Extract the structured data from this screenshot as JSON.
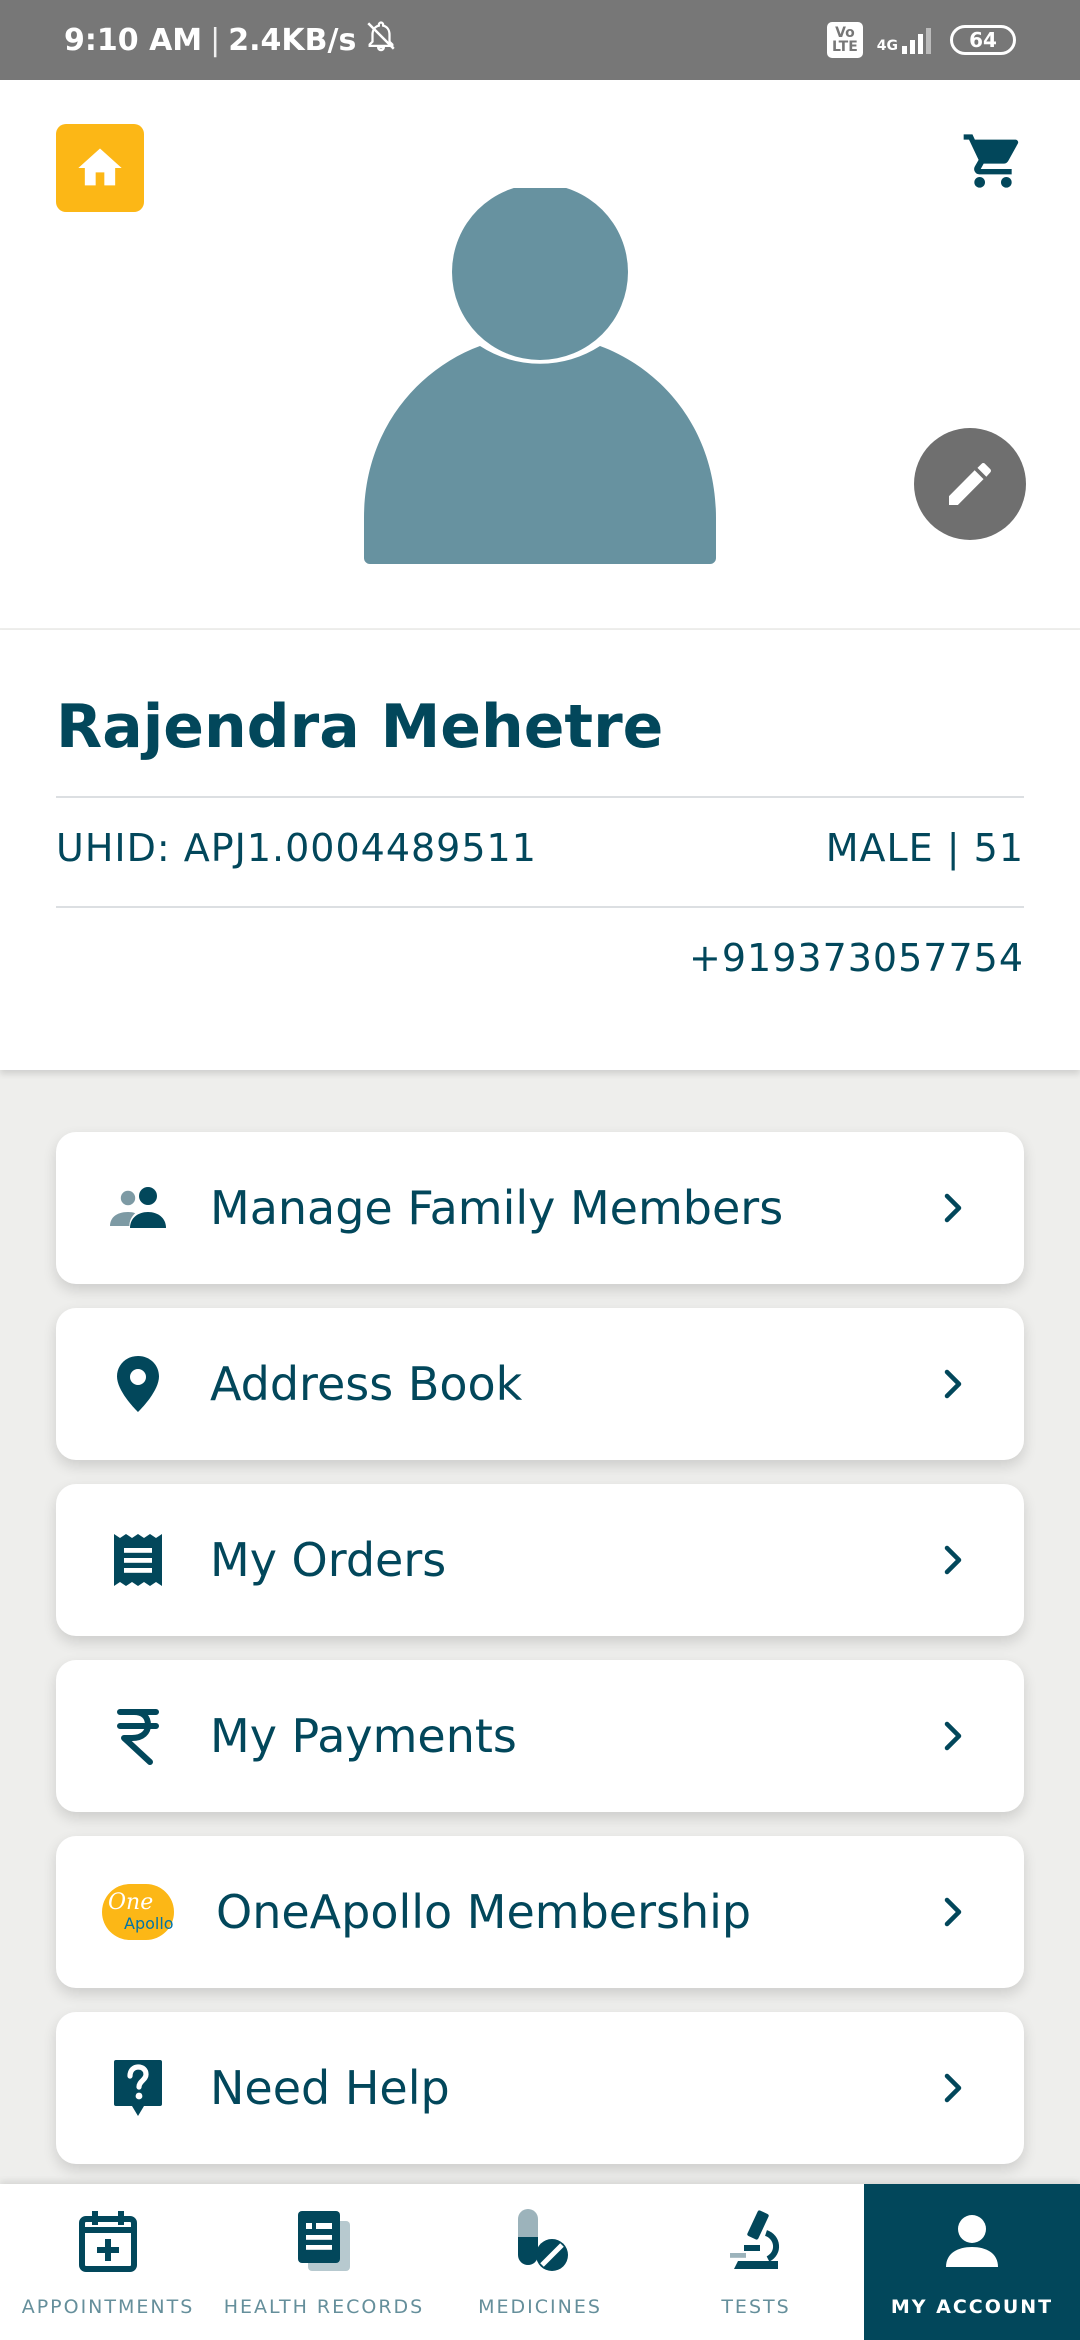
{
  "status_bar": {
    "time": "9:10 AM",
    "separator": "|",
    "speed": "2.4KB/s",
    "volte_top": "Vo",
    "volte_bottom": "LTE",
    "network": "4G",
    "battery": "64"
  },
  "header": {
    "home_icon": "home-icon",
    "cart_icon": "cart-icon",
    "edit_icon": "pencil-icon",
    "avatar_color": "#6792a0",
    "accent_color": "#fcb716"
  },
  "profile": {
    "name": "Rajendra Mehetre",
    "uhid": "UHID: APJ1.0004489511",
    "gender_age": "MALE | 51",
    "phone": "+919373057754"
  },
  "menu": [
    {
      "label": "Manage Family Members",
      "icon": "family-icon"
    },
    {
      "label": "Address Book",
      "icon": "location-pin-icon"
    },
    {
      "label": "My Orders",
      "icon": "receipt-icon"
    },
    {
      "label": "My Payments",
      "icon": "rupee-icon"
    },
    {
      "label": "OneApollo Membership",
      "icon": "oneapollo-logo",
      "logo_text_1": "One",
      "logo_text_2": "Apollo"
    },
    {
      "label": "Need Help",
      "icon": "help-icon"
    }
  ],
  "bottom_nav": [
    {
      "label": "APPOINTMENTS",
      "icon": "calendar-plus-icon",
      "active": false
    },
    {
      "label": "HEALTH RECORDS",
      "icon": "records-icon",
      "active": false
    },
    {
      "label": "MEDICINES",
      "icon": "pills-icon",
      "active": false
    },
    {
      "label": "TESTS",
      "icon": "microscope-icon",
      "active": false
    },
    {
      "label": "MY ACCOUNT",
      "icon": "person-icon",
      "active": true
    }
  ],
  "colors": {
    "primary": "#02475b",
    "active_nav": "#02475b",
    "inactive_nav_text": "#658f9b"
  }
}
